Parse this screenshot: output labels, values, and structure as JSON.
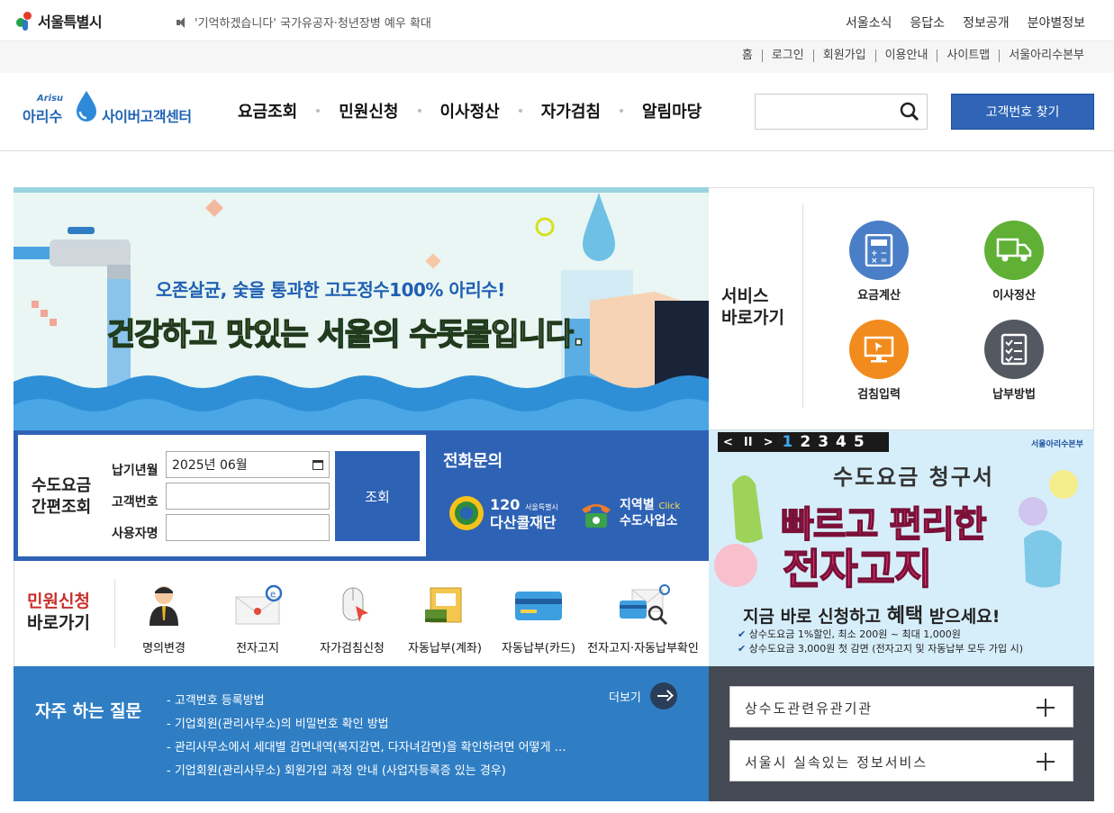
{
  "top": {
    "seoul_logo": "서울특별시",
    "notice": "'기억하겠습니다' 국가유공자·청년장병 예우 확대",
    "menu": [
      "서울소식",
      "응답소",
      "정보공개",
      "분야별정보"
    ]
  },
  "util": [
    "홈",
    "로그인",
    "회원가입",
    "이용안내",
    "사이트맵",
    "서울아리수본부"
  ],
  "gnb": {
    "logo_en": "Arisu",
    "logo_ko": "아리수",
    "logo_center": "사이버고객센터",
    "menu": [
      "요금조회",
      "민원신청",
      "이사정산",
      "자가검침",
      "알림마당"
    ],
    "search_placeholder": "",
    "find_button": "고객번호 찾기"
  },
  "banner": {
    "line1": "오존살균, 숯을 통과한 고도정수100% 아리수!",
    "line2_parts": [
      "건강",
      "하고 ",
      "맛있는",
      " ",
      "서울의 수돗물",
      "입니다."
    ]
  },
  "quick": {
    "title_line1": "서비스",
    "title_line2": "바로가기",
    "items": [
      {
        "label": "요금계산",
        "icon": "calculator-icon",
        "color": "#4a7fc7"
      },
      {
        "label": "이사정산",
        "icon": "truck-icon",
        "color": "#5fb035"
      },
      {
        "label": "검침입력",
        "icon": "monitor-icon",
        "color": "#f28b1d"
      },
      {
        "label": "납부방법",
        "icon": "checklist-icon",
        "color": "#545861"
      }
    ]
  },
  "lookup": {
    "title_line1": "수도요금",
    "title_line2": "간편조회",
    "label_month": "납기년월",
    "value_month": "2025년 06월",
    "label_customer": "고객번호",
    "value_customer": "",
    "label_user": "사용자명",
    "value_user": "",
    "button": "조회"
  },
  "phone": {
    "title": "전화문의",
    "dasan_num": "120",
    "dasan_small": "서울특별시",
    "dasan_name": "다산콜재단",
    "region_line1": "지역별",
    "region_click": "Click",
    "region_line2": "수도사업소"
  },
  "civil": {
    "title_line1": "민원신청",
    "title_line2": "바로가기",
    "items": [
      "명의변경",
      "전자고지",
      "자가검침신청",
      "자동납부(계좌)",
      "자동납부(카드)",
      "전자고지·자동납부확인"
    ]
  },
  "ad": {
    "controls": {
      "prev": "<",
      "pause": "II",
      "next": ">",
      "pages": [
        "1",
        "2",
        "3",
        "4",
        "5"
      ],
      "active": 1
    },
    "logo": "서울아리수본부",
    "line1": "수도요금 청구서",
    "line2": "빠르고 편리한",
    "line3": "전자고지",
    "line4_a": "지금 바로 신청하고 ",
    "line4_b": "혜택",
    "line4_c": " 받으세요!",
    "line5": "상수도요금 1%할인, 최소 200원 ~ 최대 1,000원",
    "line6": "상수도요금 3,000원 첫 감면 (전자고지 및 자동납부 모두 가입 시)"
  },
  "faq": {
    "title": "자주 하는 질문",
    "more": "더보기",
    "items": [
      "- 고객번호 등록방법",
      "- 기업회원(관리사무소)의 비밀번호 확인 방법",
      "- 관리사무소에서 세대별 감면내역(복지감면, 다자녀감면)을 확인하려면 어떻게 …",
      "- 기업회원(관리사무소) 회원가입 과정 안내 (사업자등록증 있는 경우)"
    ]
  },
  "related": [
    "상수도관련유관기관",
    "서울시 실속있는 정보서비스"
  ]
}
